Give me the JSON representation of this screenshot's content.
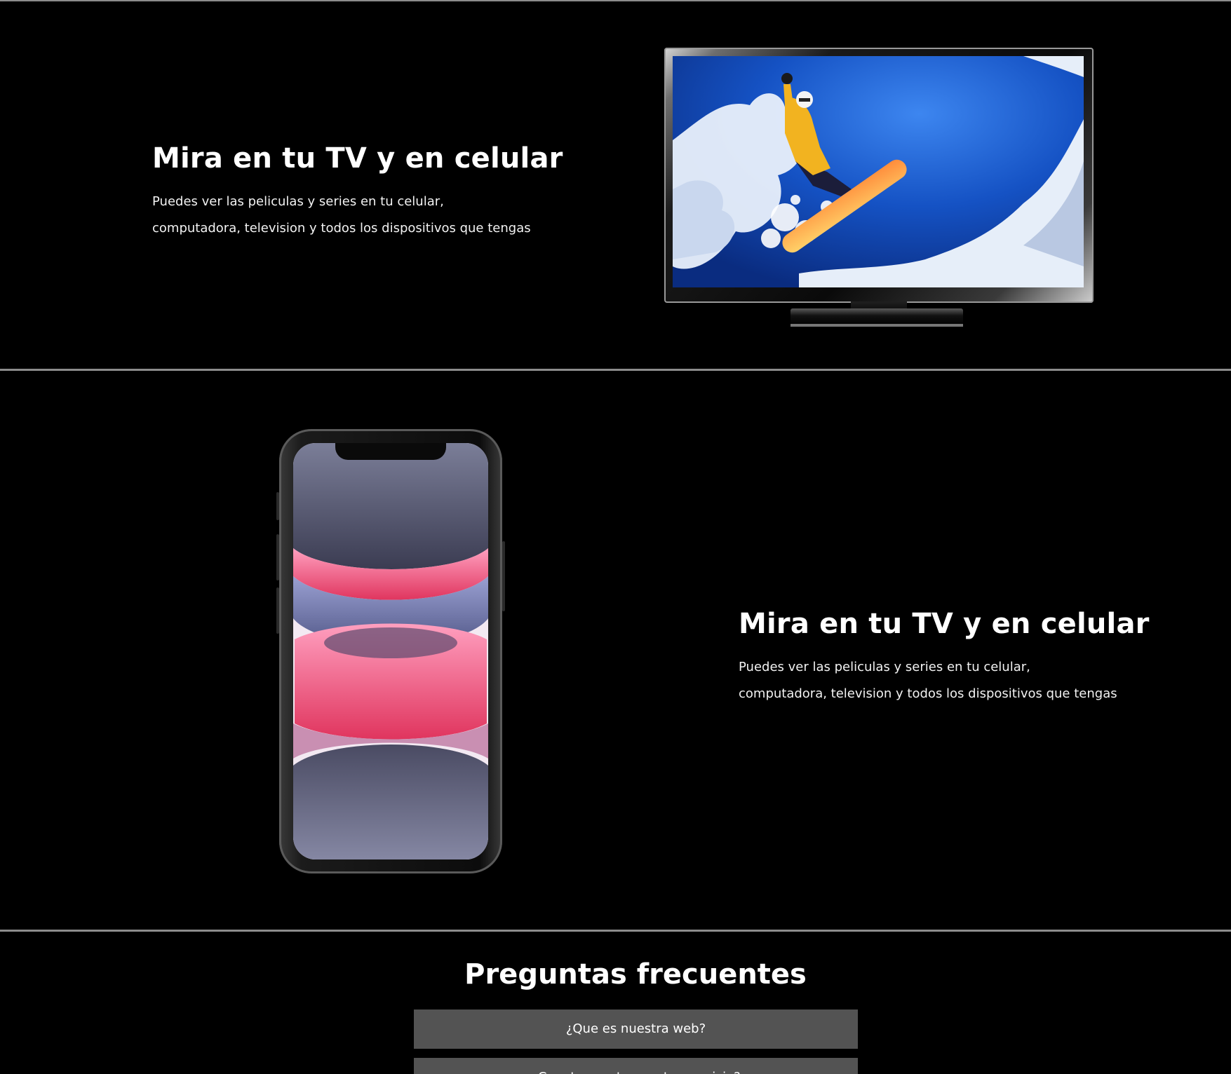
{
  "features": [
    {
      "title": "Mira en tu TV y en celular",
      "desc_line1": "Puedes ver las peliculas y series en tu celular,",
      "desc_line2": "computadora, television y todos los dispositivos que tengas",
      "image": "tv-snowboarder"
    },
    {
      "title": "Mira en tu TV y en celular",
      "desc_line1": "Puedes ver las peliculas y series en tu celular,",
      "desc_line2": "computadora, television y todos los dispositivos que tengas",
      "image": "smartphone"
    }
  ],
  "faq": {
    "title": "Preguntas frecuentes",
    "items": [
      {
        "question": "¿Que es nuestra web?"
      },
      {
        "question": "¿Cuanto cuesta nuestro servicio?"
      }
    ]
  },
  "colors": {
    "background": "#000000",
    "divider": "#8c8c8c",
    "faq_item_bg": "#535353",
    "text": "#ffffff"
  }
}
